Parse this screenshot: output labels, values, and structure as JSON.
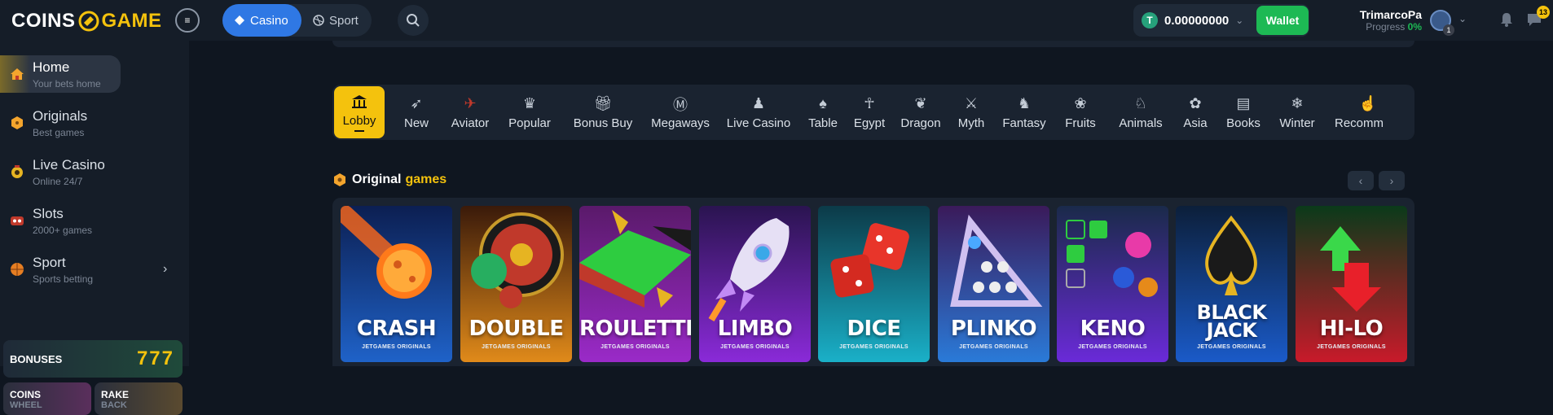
{
  "header": {
    "logo_left": "COINS",
    "logo_right": "GAME",
    "modes": [
      {
        "label": "Casino"
      },
      {
        "label": "Sport"
      }
    ],
    "balance": "0.00000000",
    "coin_symbol": "T",
    "wallet_label": "Wallet",
    "user_name": "TrimarcoPa",
    "progress_label": "Progress",
    "progress_value": "0%",
    "avatar_level": "1",
    "chat_count": "13"
  },
  "sidebar": {
    "items": [
      {
        "label": "Home",
        "sub": "Your bets home"
      },
      {
        "label": "Originals",
        "sub": "Best games"
      },
      {
        "label": "Live Casino",
        "sub": "Online 24/7"
      },
      {
        "label": "Slots",
        "sub": "2000+ games"
      },
      {
        "label": "Sport",
        "sub": "Sports betting"
      }
    ],
    "bonuses_label": "BONUSES",
    "bonuses_art": "777",
    "mini_cards": [
      {
        "title": "COINS",
        "sub": "WHEEL"
      },
      {
        "title": "RAKE",
        "sub": "BACK"
      }
    ]
  },
  "categories": [
    {
      "label": "Lobby",
      "icon": "lobby-icon"
    },
    {
      "label": "New",
      "icon": "rocket-icon"
    },
    {
      "label": "Aviator",
      "icon": "plane-icon"
    },
    {
      "label": "Popular",
      "icon": "crown-icon"
    },
    {
      "label": "Bonus Buy",
      "icon": "gift-icon"
    },
    {
      "label": "Megaways",
      "icon": "megaways-icon"
    },
    {
      "label": "Live Casino",
      "icon": "dealer-icon"
    },
    {
      "label": "Table",
      "icon": "cards-icon"
    },
    {
      "label": "Egypt",
      "icon": "ankh-icon"
    },
    {
      "label": "Dragon",
      "icon": "dragon-icon"
    },
    {
      "label": "Myth",
      "icon": "myth-icon"
    },
    {
      "label": "Fantasy",
      "icon": "unicorn-icon"
    },
    {
      "label": "Fruits",
      "icon": "cherry-icon"
    },
    {
      "label": "Animals",
      "icon": "animal-icon"
    },
    {
      "label": "Asia",
      "icon": "lotus-icon"
    },
    {
      "label": "Books",
      "icon": "book-icon"
    },
    {
      "label": "Winter",
      "icon": "snowflake-icon"
    },
    {
      "label": "Recomm",
      "icon": "thumbs-up-icon"
    }
  ],
  "section": {
    "title_white": "Original",
    "title_accent": "games"
  },
  "games": [
    {
      "title": "CRASH",
      "sub": "JETGAMES ORIGINALS"
    },
    {
      "title": "DOUBLE",
      "sub": "JETGAMES ORIGINALS"
    },
    {
      "title": "ROULETTE",
      "sub": "JETGAMES ORIGINALS"
    },
    {
      "title": "LIMBO",
      "sub": "JETGAMES ORIGINALS"
    },
    {
      "title": "DICE",
      "sub": "JETGAMES ORIGINALS"
    },
    {
      "title": "PLINKO",
      "sub": "JETGAMES ORIGINALS"
    },
    {
      "title": "KENO",
      "sub": "JETGAMES ORIGINALS"
    },
    {
      "title_line1": "BLACK",
      "title_line2": "JACK",
      "sub": "JETGAMES ORIGINALS"
    },
    {
      "title": "HI-LO",
      "sub": "JETGAMES ORIGINALS"
    }
  ],
  "colors": {
    "accent": "#f4c20d",
    "primary": "#2f78e4",
    "wallet": "#1db954",
    "background": "#0f1620",
    "panel": "#1a2330"
  }
}
